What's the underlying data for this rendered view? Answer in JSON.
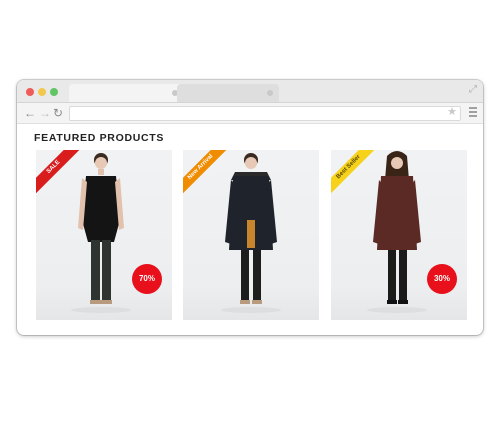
{
  "page": {
    "section_title": "FEATURED PRODUCTS"
  },
  "browser": {
    "controls": [
      "close",
      "minimize",
      "maximize"
    ],
    "nav_icons": [
      "back-arrow-icon",
      "forward-arrow-icon",
      "reload-icon"
    ],
    "toolbar_icons": [
      "star-icon",
      "menu-icon",
      "expand-icon"
    ]
  },
  "products": [
    {
      "ribbon": "SALE",
      "ribbon_color": "#d91c1c",
      "badge": "70%",
      "coat_color": "#1c1c1c"
    },
    {
      "ribbon": "New Arrival",
      "ribbon_color": "#f08c00",
      "badge": "",
      "coat_color": "#1f232b"
    },
    {
      "ribbon": "Best Seller",
      "ribbon_color": "#f7d21a",
      "badge": "30%",
      "coat_color": "#5b2a24"
    }
  ],
  "colors": {
    "badge": "#e8101b",
    "window_bg": "#e9e9e9"
  }
}
